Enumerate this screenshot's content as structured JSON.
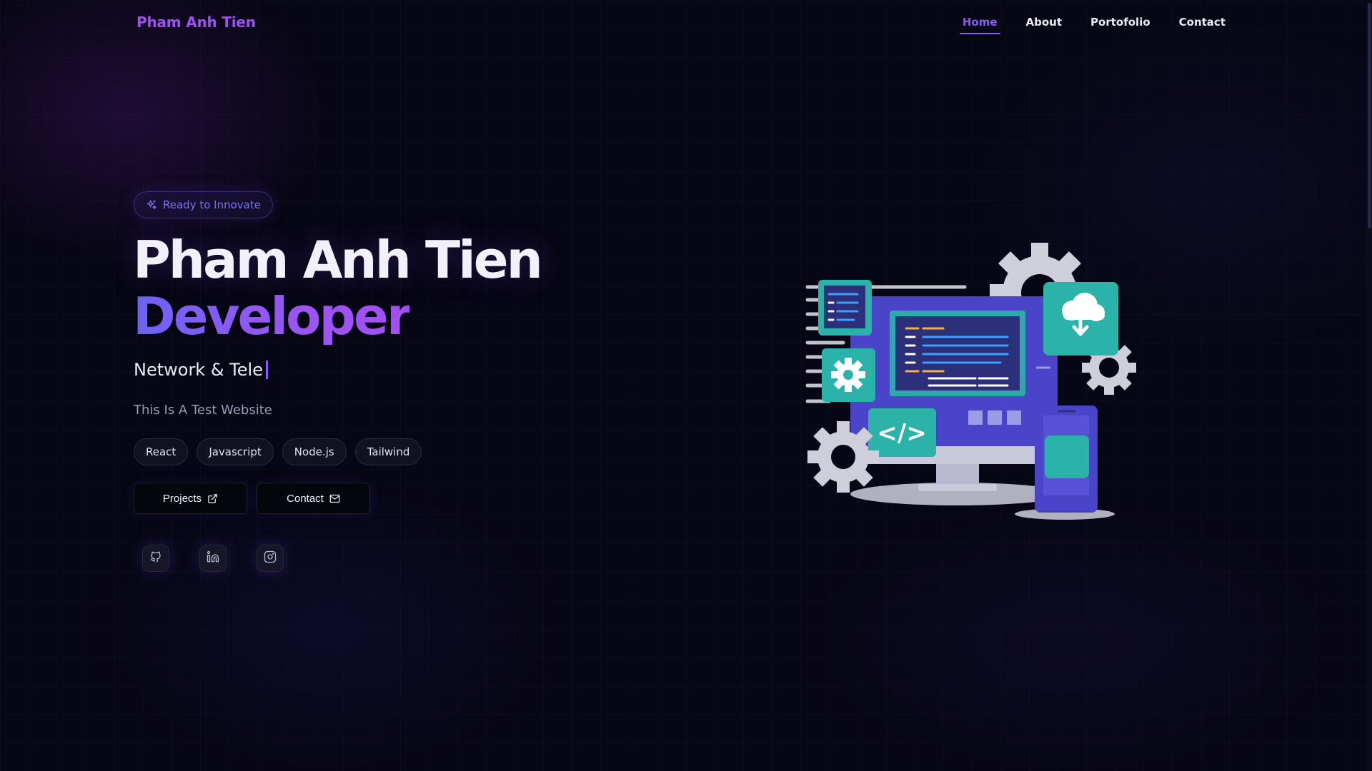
{
  "brand": {
    "name": "Pham Anh Tien",
    "color": "#a04ff0"
  },
  "nav": {
    "items": [
      {
        "label": "Home",
        "active": true
      },
      {
        "label": "About",
        "active": false
      },
      {
        "label": "Portofolio",
        "active": false
      },
      {
        "label": "Contact",
        "active": false
      }
    ]
  },
  "hero": {
    "badge": {
      "label": "Ready to Innovate",
      "icon": "sparkles-icon"
    },
    "title": "Pham Anh Tien",
    "role": "Developer",
    "typing_text": "Network & Tele",
    "subtitle": "This Is A Test Website",
    "tags": [
      "React",
      "Javascript",
      "Node.js",
      "Tailwind"
    ],
    "buttons": {
      "projects": {
        "label": "Projects",
        "icon": "external-link-icon"
      },
      "contact": {
        "label": "Contact",
        "icon": "mail-icon"
      }
    },
    "socials": [
      {
        "name": "github",
        "icon": "github-icon"
      },
      {
        "name": "linkedin",
        "icon": "linkedin-icon"
      },
      {
        "name": "instagram",
        "icon": "instagram-icon"
      }
    ]
  },
  "colors": {
    "accent": "#8b5cf6",
    "gradient_start": "#6d63f3",
    "gradient_end": "#a24ff0",
    "background": "#070614"
  }
}
